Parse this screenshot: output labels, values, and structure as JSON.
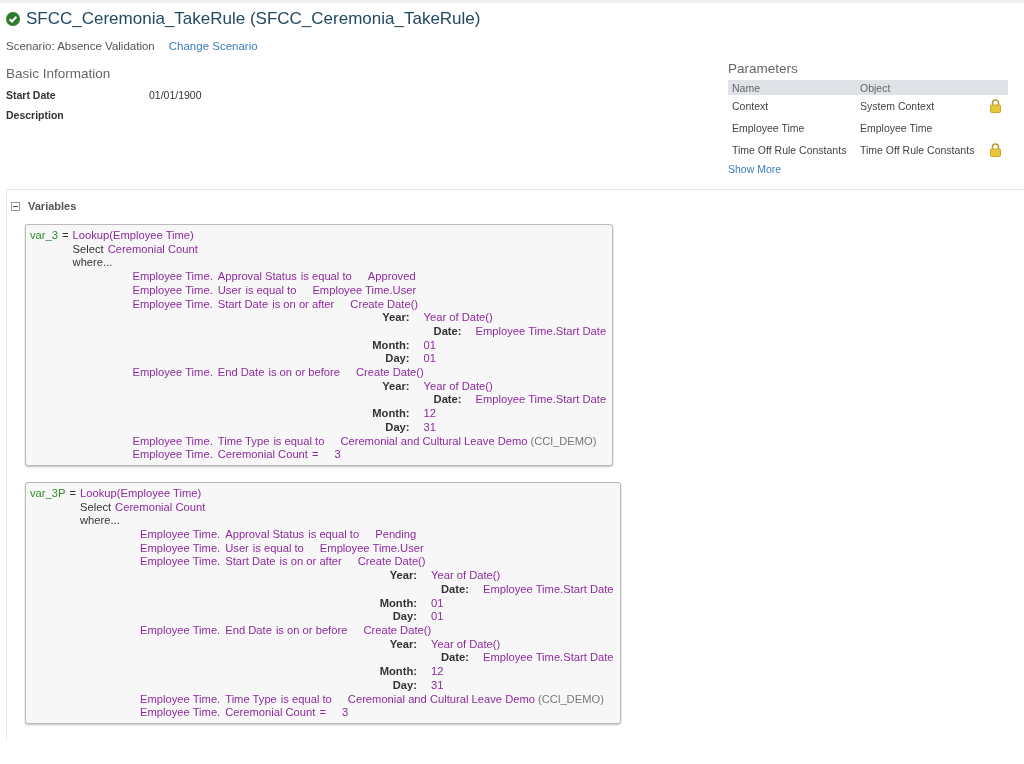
{
  "header": {
    "valid": true,
    "title": "SFCC_Ceremonia_TakeRule (SFCC_Ceremonia_TakeRule)",
    "scenario": "Scenario: Absence Validation",
    "change_link": "Change Scenario"
  },
  "basic_information": {
    "heading": "Basic Information",
    "fields": [
      {
        "label": "Start Date",
        "value": "01/01/1900"
      },
      {
        "label": "Description"
      }
    ]
  },
  "parameters": {
    "heading": "Parameters",
    "columns": [
      "Name",
      "Object"
    ],
    "rows": [
      {
        "name": "Context",
        "object": "System Context",
        "locked": true
      },
      {
        "name": "Employee Time",
        "object": "Employee Time",
        "locked": false
      },
      {
        "name": "Time Off Rule Constants",
        "object": "Time Off Rule Constants",
        "locked": true
      }
    ],
    "show_more": "Show More"
  },
  "variables": {
    "heading": "Variables",
    "expanded": true,
    "blocks": [
      {
        "name": "var_3",
        "operator": "=",
        "function": "Lookup(Employee Time)",
        "select_keyword": "Select",
        "select_field": "Ceremonial Count",
        "where": "where...",
        "conditions": [
          {
            "kind": "compare",
            "object": "Employee Time.",
            "field": "Approval Status",
            "op": "is equal to",
            "value": "Approved"
          },
          {
            "kind": "compare",
            "object": "Employee Time.",
            "field": "User",
            "op": "is equal to",
            "value": "Employee Time.User"
          },
          {
            "kind": "date",
            "object": "Employee Time.",
            "field": "Start Date",
            "op": "is on or after",
            "value": "Create Date()",
            "parts": [
              {
                "label": "Year:",
                "value": "Year of Date()",
                "children": [
                  {
                    "label": "Date:",
                    "value": "Employee Time.Start Date"
                  }
                ]
              },
              {
                "label": "Month:",
                "value": "01"
              },
              {
                "label": "Day:",
                "value": "01"
              }
            ]
          },
          {
            "kind": "date",
            "object": "Employee Time.",
            "field": "End Date",
            "op": "is on or before",
            "value": "Create Date()",
            "parts": [
              {
                "label": "Year:",
                "value": "Year of Date()",
                "children": [
                  {
                    "label": "Date:",
                    "value": "Employee Time.Start Date"
                  }
                ]
              },
              {
                "label": "Month:",
                "value": "12"
              },
              {
                "label": "Day:",
                "value": "31"
              }
            ]
          },
          {
            "kind": "compare",
            "object": "Employee Time.",
            "field": "Time Type",
            "op": "is equal to",
            "value": "Ceremonial and Cultural Leave Demo",
            "note": "(CCl_DEMO)"
          },
          {
            "kind": "compare",
            "object": "Employee Time.",
            "field": "Ceremonial Count",
            "op": "=",
            "value": "3"
          }
        ]
      },
      {
        "name": "var_3P",
        "operator": "=",
        "function": "Lookup(Employee Time)",
        "select_keyword": "Select",
        "select_field": "Ceremonial Count",
        "where": "where...",
        "conditions": [
          {
            "kind": "compare",
            "object": "Employee Time.",
            "field": "Approval Status",
            "op": "is equal to",
            "value": "Pending"
          },
          {
            "kind": "compare",
            "object": "Employee Time.",
            "field": "User",
            "op": "is equal to",
            "value": "Employee Time.User"
          },
          {
            "kind": "date",
            "object": "Employee Time.",
            "field": "Start Date",
            "op": "is on or after",
            "value": "Create Date()",
            "parts": [
              {
                "label": "Year:",
                "value": "Year of Date()",
                "children": [
                  {
                    "label": "Date:",
                    "value": "Employee Time.Start Date"
                  }
                ]
              },
              {
                "label": "Month:",
                "value": "01"
              },
              {
                "label": "Day:",
                "value": "01"
              }
            ]
          },
          {
            "kind": "date",
            "object": "Employee Time.",
            "field": "End Date",
            "op": "is on or before",
            "value": "Create Date()",
            "parts": [
              {
                "label": "Year:",
                "value": "Year of Date()",
                "children": [
                  {
                    "label": "Date:",
                    "value": "Employee Time.Start Date"
                  }
                ]
              },
              {
                "label": "Month:",
                "value": "12"
              },
              {
                "label": "Day:",
                "value": "31"
              }
            ]
          },
          {
            "kind": "compare",
            "object": "Employee Time.",
            "field": "Time Type",
            "op": "is equal to",
            "value": "Ceremonial and Cultural Leave Demo",
            "note": "(CCl_DEMO)"
          },
          {
            "kind": "compare",
            "object": "Employee Time.",
            "field": "Ceremonial Count",
            "op": "=",
            "value": "3"
          }
        ]
      }
    ]
  }
}
